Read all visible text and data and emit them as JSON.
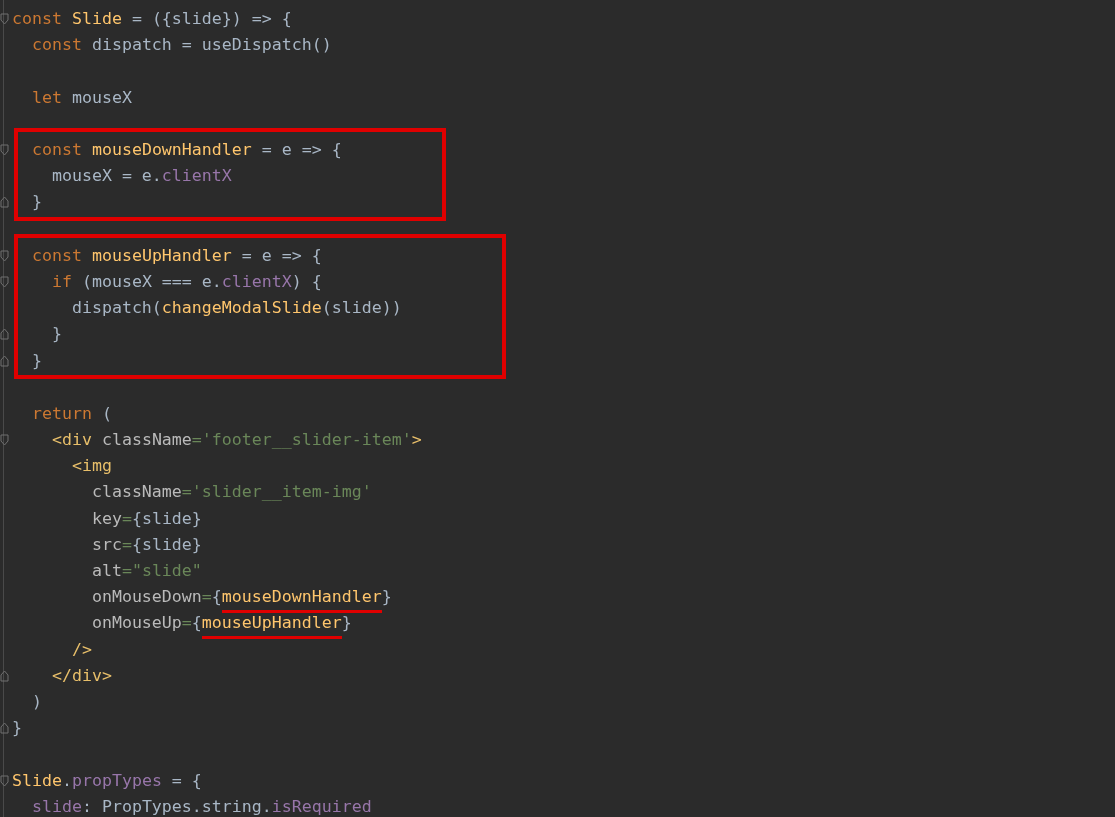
{
  "blocks": [
    {
      "highlighted": false,
      "lines": [
        {
          "kind": "opener",
          "tokens": [
            {
              "kind": "keyword",
              "text": "const "
            },
            {
              "kind": "function",
              "text": "Slide"
            },
            {
              "kind": "plain",
              "text": " = ({slide}) => {"
            }
          ]
        },
        {
          "kind": "code",
          "tokens": [
            {
              "kind": "keyword",
              "text": "  const"
            },
            {
              "kind": "plain",
              "text": " dispatch = useDispatch()"
            }
          ]
        },
        {
          "kind": "blank"
        },
        {
          "kind": "code",
          "tokens": [
            {
              "kind": "keyword",
              "text": "  let"
            },
            {
              "kind": "plain",
              "text": " mouseX"
            }
          ]
        },
        {
          "kind": "blank"
        }
      ]
    },
    {
      "highlighted": true,
      "lines": [
        {
          "kind": "opener",
          "tokens": [
            {
              "kind": "keyword",
              "text": "  const "
            },
            {
              "kind": "function",
              "text": "mouseDownHandler"
            },
            {
              "kind": "plain",
              "text": " = e => {"
            }
          ]
        },
        {
          "kind": "code",
          "tokens": [
            {
              "kind": "plain",
              "text": "    mouseX = e."
            },
            {
              "kind": "property",
              "text": "clientX"
            }
          ]
        },
        {
          "kind": "closer",
          "tokens": [
            {
              "kind": "plain",
              "text": "  }"
            }
          ]
        }
      ]
    },
    {
      "highlighted": false,
      "lines": [
        {
          "kind": "blank"
        }
      ]
    },
    {
      "highlighted": true,
      "lines": [
        {
          "kind": "opener",
          "tokens": [
            {
              "kind": "keyword",
              "text": "  const "
            },
            {
              "kind": "function",
              "text": "mouseUpHandler"
            },
            {
              "kind": "plain",
              "text": " = e => {"
            }
          ]
        },
        {
          "kind": "opener",
          "tokens": [
            {
              "kind": "keyword",
              "text": "    if"
            },
            {
              "kind": "plain",
              "text": " (mouseX === e."
            },
            {
              "kind": "property",
              "text": "clientX"
            },
            {
              "kind": "plain",
              "text": ") {"
            }
          ]
        },
        {
          "kind": "code",
          "tokens": [
            {
              "kind": "plain",
              "text": "      dispatch("
            },
            {
              "kind": "function",
              "text": "changeModalSlide"
            },
            {
              "kind": "plain",
              "text": "(slide))"
            }
          ]
        },
        {
          "kind": "closer",
          "tokens": [
            {
              "kind": "plain",
              "text": "    }"
            }
          ]
        },
        {
          "kind": "closer",
          "tokens": [
            {
              "kind": "plain",
              "text": "  }"
            }
          ]
        }
      ]
    },
    {
      "highlighted": false,
      "lines": [
        {
          "kind": "blank"
        },
        {
          "kind": "code",
          "tokens": [
            {
              "kind": "keyword",
              "text": "  return"
            },
            {
              "kind": "plain",
              "text": " ("
            }
          ]
        },
        {
          "kind": "opener",
          "tokens": [
            {
              "kind": "tag",
              "text": "    <div"
            },
            {
              "kind": "attribute",
              "text": " className"
            },
            {
              "kind": "string",
              "text": "='footer__slider-item'"
            },
            {
              "kind": "tag",
              "text": ">"
            }
          ]
        },
        {
          "kind": "code",
          "tokens": [
            {
              "kind": "tag",
              "text": "      <img"
            }
          ]
        },
        {
          "kind": "code",
          "tokens": [
            {
              "kind": "attribute",
              "text": "        className"
            },
            {
              "kind": "string",
              "text": "='slider__item-img'"
            }
          ]
        },
        {
          "kind": "code",
          "tokens": [
            {
              "kind": "attribute",
              "text": "        key"
            },
            {
              "kind": "string",
              "text": "="
            },
            {
              "kind": "plain",
              "text": "{slide}"
            }
          ]
        },
        {
          "kind": "code",
          "tokens": [
            {
              "kind": "attribute",
              "text": "        src"
            },
            {
              "kind": "string",
              "text": "="
            },
            {
              "kind": "plain",
              "text": "{slide}"
            }
          ]
        },
        {
          "kind": "code",
          "tokens": [
            {
              "kind": "attribute",
              "text": "        alt"
            },
            {
              "kind": "string",
              "text": "=\"slide\""
            }
          ]
        },
        {
          "kind": "code",
          "tokens": [
            {
              "kind": "attribute",
              "text": "        onMouseDown"
            },
            {
              "kind": "string",
              "text": "="
            },
            {
              "kind": "plain",
              "text": "{"
            },
            {
              "kind": "function",
              "text": "mouseDownHandler",
              "underlined": true
            },
            {
              "kind": "plain",
              "text": "}"
            }
          ]
        },
        {
          "kind": "code",
          "tokens": [
            {
              "kind": "attribute",
              "text": "        onMouseUp"
            },
            {
              "kind": "string",
              "text": "="
            },
            {
              "kind": "plain",
              "text": "{"
            },
            {
              "kind": "function",
              "text": "mouseUpHandler",
              "underlined": true
            },
            {
              "kind": "plain",
              "text": "}"
            }
          ]
        },
        {
          "kind": "code",
          "tokens": [
            {
              "kind": "tag",
              "text": "      />"
            }
          ]
        },
        {
          "kind": "closer",
          "tokens": [
            {
              "kind": "tag",
              "text": "    </div>"
            }
          ]
        },
        {
          "kind": "code",
          "tokens": [
            {
              "kind": "plain",
              "text": "  )"
            }
          ]
        },
        {
          "kind": "closer",
          "tokens": [
            {
              "kind": "plain",
              "text": "}"
            }
          ]
        },
        {
          "kind": "blank"
        },
        {
          "kind": "opener",
          "tokens": [
            {
              "kind": "function",
              "text": "Slide"
            },
            {
              "kind": "plain",
              "text": "."
            },
            {
              "kind": "property",
              "text": "propTypes"
            },
            {
              "kind": "plain",
              "text": " = {"
            }
          ]
        },
        {
          "kind": "code",
          "tokens": [
            {
              "kind": "property",
              "text": "  slide"
            },
            {
              "kind": "plain",
              "text": ": PropTypes.string."
            },
            {
              "kind": "property",
              "text": "isRequired"
            }
          ]
        }
      ]
    }
  ]
}
